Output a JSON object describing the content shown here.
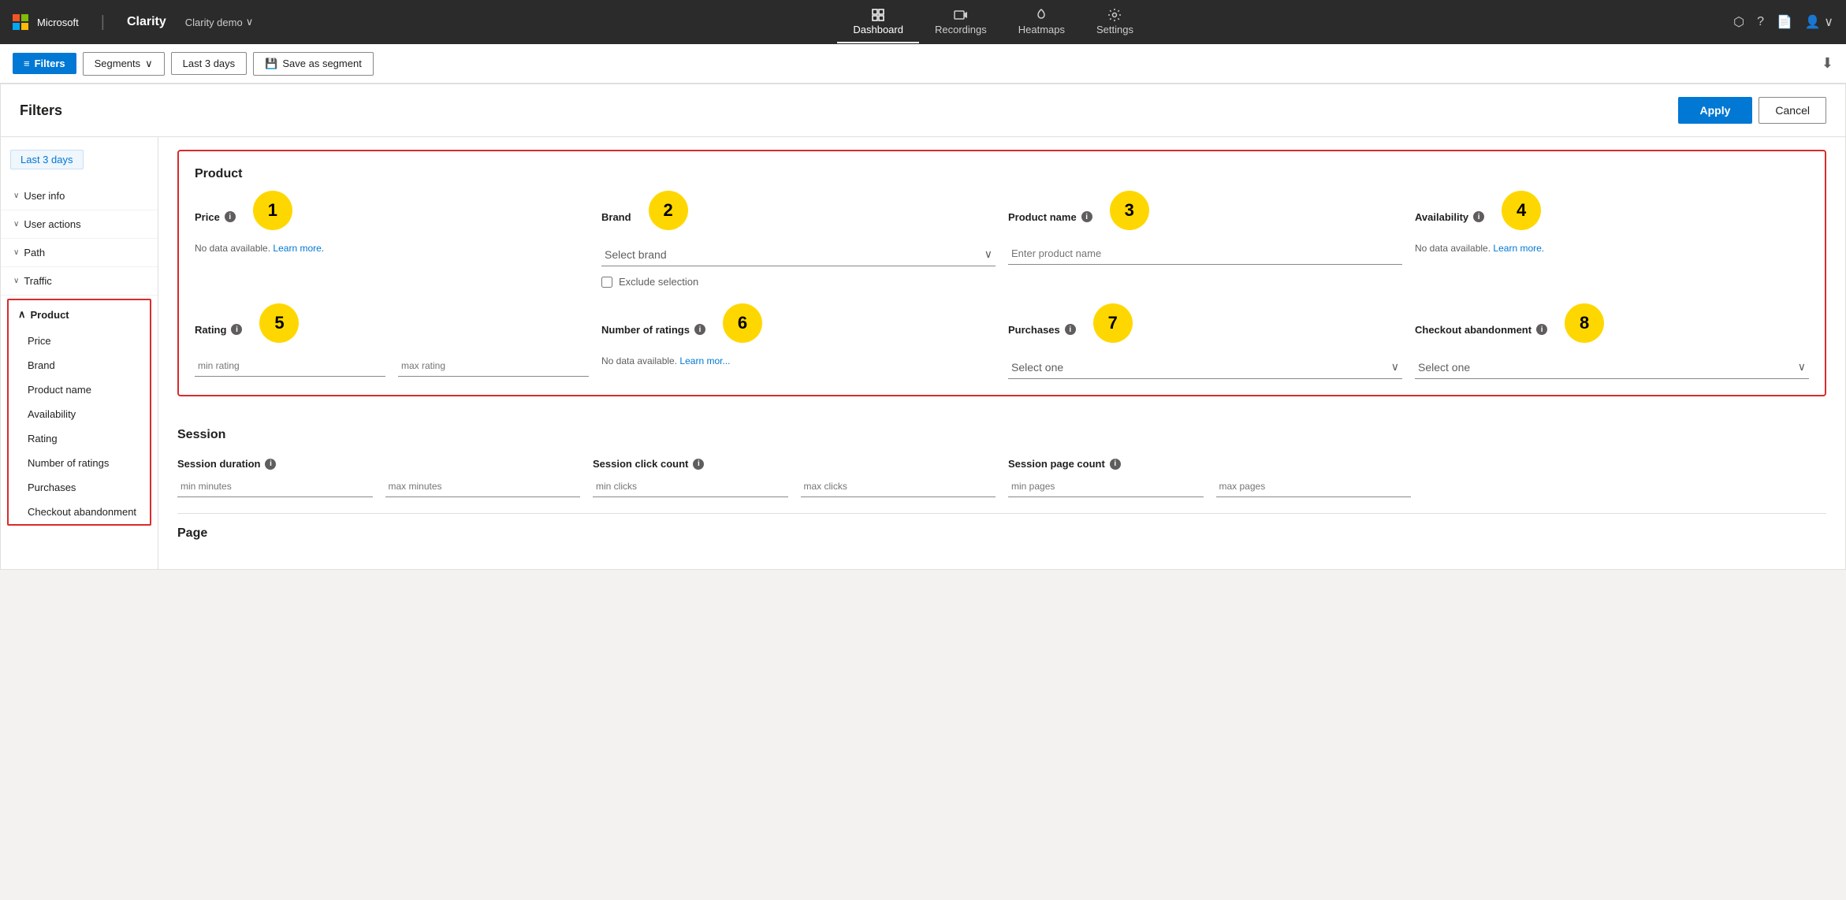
{
  "topNav": {
    "brand": "Clarity",
    "demo": "Clarity demo",
    "tabs": [
      {
        "id": "dashboard",
        "label": "Dashboard",
        "active": true
      },
      {
        "id": "recordings",
        "label": "Recordings",
        "active": false
      },
      {
        "id": "heatmaps",
        "label": "Heatmaps",
        "active": false
      },
      {
        "id": "settings",
        "label": "Settings",
        "active": false
      }
    ]
  },
  "toolbar": {
    "filters_label": "Filters",
    "segments_label": "Segments",
    "date_label": "Last 3 days",
    "save_label": "Save as segment",
    "apply_label": "Apply",
    "cancel_label": "Cancel"
  },
  "filters": {
    "title": "Filters",
    "date_badge": "Last 3 days",
    "sidebar": {
      "groups": [
        {
          "id": "user-info",
          "label": "User info",
          "expanded": false
        },
        {
          "id": "user-actions",
          "label": "User actions",
          "expanded": false
        },
        {
          "id": "path",
          "label": "Path",
          "expanded": false
        },
        {
          "id": "traffic",
          "label": "Traffic",
          "expanded": false
        }
      ],
      "product_group": {
        "label": "Product",
        "items": [
          "Price",
          "Brand",
          "Product name",
          "Availability",
          "Rating",
          "Number of ratings",
          "Purchases",
          "Checkout abandonment"
        ]
      }
    },
    "product_section": {
      "title": "Product",
      "fields": [
        {
          "id": "price",
          "label": "Price",
          "has_info": true,
          "badge": "1",
          "type": "no-data",
          "no_data_text": "No data available.",
          "learn_more": "Learn more."
        },
        {
          "id": "brand",
          "label": "Brand",
          "has_info": false,
          "badge": "2",
          "type": "select",
          "placeholder": "Select brand",
          "exclude_label": "Exclude selection"
        },
        {
          "id": "product-name",
          "label": "Product name",
          "has_info": true,
          "badge": "3",
          "type": "input",
          "placeholder": "Enter product name"
        },
        {
          "id": "availability",
          "label": "Availability",
          "has_info": true,
          "badge": "4",
          "type": "no-data",
          "no_data_text": "No data available.",
          "learn_more": "Learn more."
        },
        {
          "id": "rating",
          "label": "Rating",
          "has_info": true,
          "badge": "5",
          "type": "range",
          "min_placeholder": "min rating",
          "max_placeholder": "max rating"
        },
        {
          "id": "number-of-ratings",
          "label": "Number of ratings",
          "has_info": true,
          "badge": "6",
          "type": "no-data",
          "no_data_text": "No data available.",
          "learn_more": "Learn mor..."
        },
        {
          "id": "purchases",
          "label": "Purchases",
          "has_info": true,
          "badge": "7",
          "type": "select",
          "placeholder": "Select one"
        },
        {
          "id": "checkout-abandonment",
          "label": "Checkout abandonment",
          "has_info": true,
          "badge": "8",
          "type": "select",
          "placeholder": "Select one"
        }
      ]
    },
    "session_section": {
      "title": "Session",
      "fields": [
        {
          "id": "session-duration",
          "label": "Session duration",
          "has_info": true,
          "type": "range",
          "min_placeholder": "min minutes",
          "max_placeholder": "max minutes"
        },
        {
          "id": "session-click-count",
          "label": "Session click count",
          "has_info": true,
          "type": "range",
          "min_placeholder": "min clicks",
          "max_placeholder": "max clicks"
        },
        {
          "id": "session-page-count",
          "label": "Session page count",
          "has_info": true,
          "type": "range",
          "min_placeholder": "min pages",
          "max_placeholder": "max pages"
        }
      ]
    },
    "page_section": {
      "title": "Page"
    }
  }
}
